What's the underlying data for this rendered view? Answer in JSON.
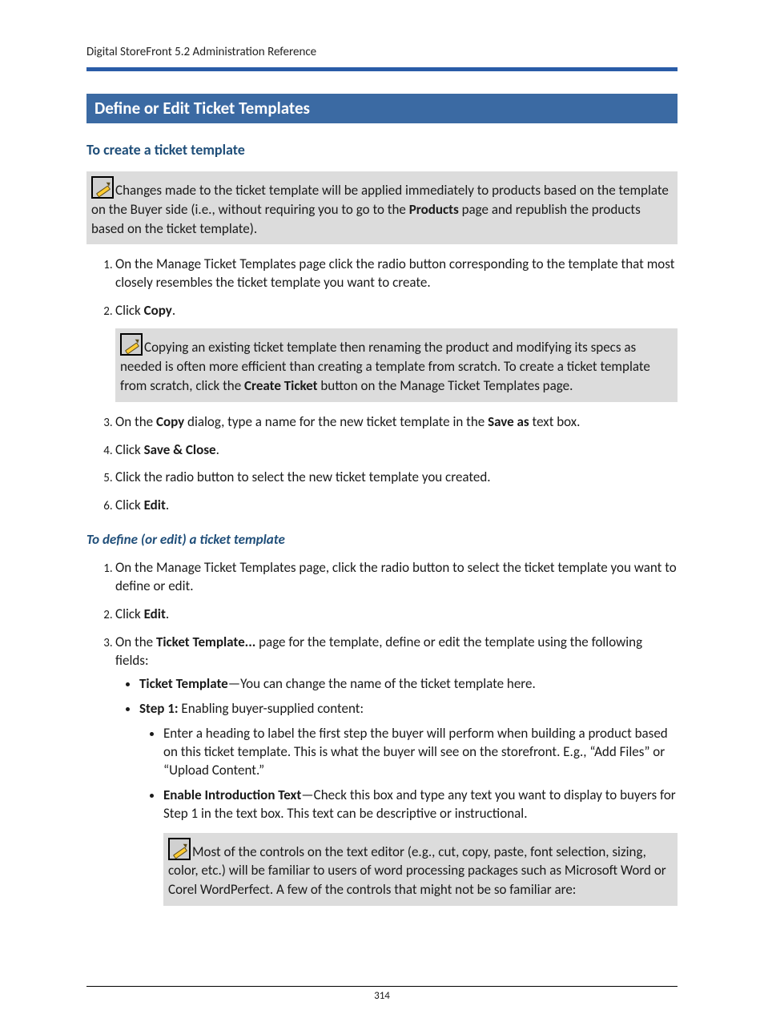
{
  "header": {
    "running": "Digital StoreFront 5.2 Administration Reference"
  },
  "section_title": "Define or Edit Ticket Templates",
  "h_create": "To create a ticket template",
  "note1": {
    "pre": "Changes made to the ticket template will be applied immediately to products based on the template on the Buyer side (i.e., without requiring you to go to the ",
    "bold": "Products",
    "post": " page and republish the products based on the ticket template)."
  },
  "list1": {
    "i1": "On the Manage Ticket Templates page click the radio button corresponding to the template that most closely resembles the ticket template you want to create.",
    "i2_pre": "Click ",
    "i2_bold": "Copy",
    "i2_post": ".",
    "note2": {
      "pre": "Copying an existing ticket template then renaming the product and modifying its specs as needed is often more efficient than creating a template from scratch. To create a ticket template from scratch, click the ",
      "bold": "Create Ticket",
      "post": " button on the Manage Ticket Templates page."
    },
    "i3_a": "On the ",
    "i3_b": "Copy",
    "i3_c": " dialog, type a name for the new ticket template in the ",
    "i3_d": "Save as",
    "i3_e": " text box.",
    "i4_a": "Click ",
    "i4_b": "Save & Close",
    "i4_c": ".",
    "i5": "Click the radio button to select the new ticket template you created.",
    "i6_a": "Click ",
    "i6_b": "Edit",
    "i6_c": "."
  },
  "h_define": "To define (or edit) a ticket template",
  "list2": {
    "i1": "On the Manage Ticket Templates page, click the radio button to select the ticket template you want to define or edit.",
    "i2_a": "Click ",
    "i2_b": "Edit",
    "i2_c": ".",
    "i3_a": "On the ",
    "i3_b": "Ticket Template...",
    "i3_c": " page for the template, define or edit the template using the following fields:",
    "b1_a": "Ticket Template",
    "b1_b": "—You can change the name of the ticket template here.",
    "b2_a": "Step 1:",
    "b2_b": " Enabling buyer-supplied content:",
    "sb1": "Enter a heading to label the first step the buyer will perform when building a product based on this ticket template. This is what the buyer will see on the storefront. E.g., “Add Files” or “Upload Content.”",
    "sb2_a": "Enable Introduction Text",
    "sb2_b": "—Check this box and type any text you want to display to buyers for Step 1 in the text box. This text can be descriptive or instructional.",
    "note3": "Most of the controls on the text editor (e.g., cut, copy, paste, font selection, sizing, color, etc.) will be familiar to users of word processing packages such as Microsoft Word or Corel WordPerfect. A few of the controls that might not be so familiar are:"
  },
  "footer": {
    "pagenum": "314"
  }
}
